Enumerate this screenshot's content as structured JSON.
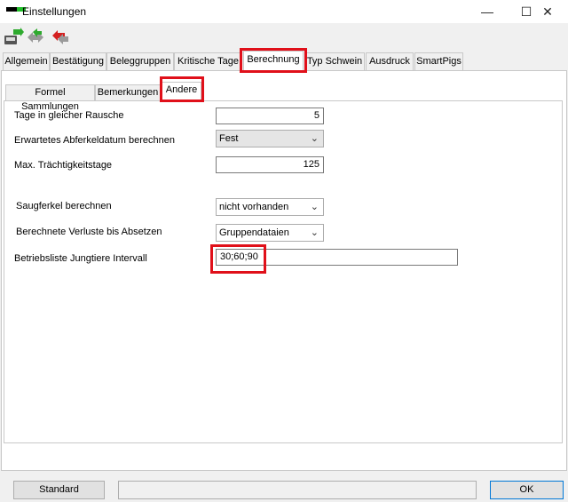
{
  "window": {
    "title": "Einstellungen",
    "controls": {
      "minimize": "—",
      "maximize": "☐",
      "close": "✕"
    }
  },
  "toolbar": {
    "icons": [
      "save-icon",
      "refresh-icon",
      "undo-icon"
    ]
  },
  "tabs": [
    {
      "label": "Allgemein",
      "active": false
    },
    {
      "label": "Bestätigung",
      "active": false
    },
    {
      "label": "Beleggruppen",
      "active": false
    },
    {
      "label": "Kritische Tage",
      "active": false
    },
    {
      "label": "Berechnung",
      "active": true
    },
    {
      "label": "Typ Schwein",
      "active": false
    },
    {
      "label": "Ausdruck",
      "active": false
    },
    {
      "label": "SmartPigs",
      "active": false
    }
  ],
  "subtabs": [
    {
      "label": "Formel Sammlungen",
      "active": false
    },
    {
      "label": "Bemerkungen",
      "active": false
    },
    {
      "label": "Andere",
      "active": true
    }
  ],
  "form": {
    "tage_label": "Tage in gleicher Rausche",
    "tage_value": "5",
    "abferkel_label": "Erwartetes Abferkeldatum berechnen",
    "abferkel_value": "Fest",
    "traechtig_label": "Max. Trächtigkeitstage",
    "traechtig_value": "125",
    "saugferkel_label": "Saugferkel berechnen",
    "saugferkel_value": "nicht vorhanden",
    "verluste_label": "Berechnete Verluste bis Absetzen",
    "verluste_value": "Gruppendataien",
    "betriebsliste_label": "Betriebsliste Jungtiere Intervall",
    "betriebsliste_value": "30;60;90"
  },
  "footer": {
    "standard_label": "Standard",
    "ok_label": "OK"
  },
  "colors": {
    "highlight": "#e0101a",
    "accent": "#0078d7"
  }
}
